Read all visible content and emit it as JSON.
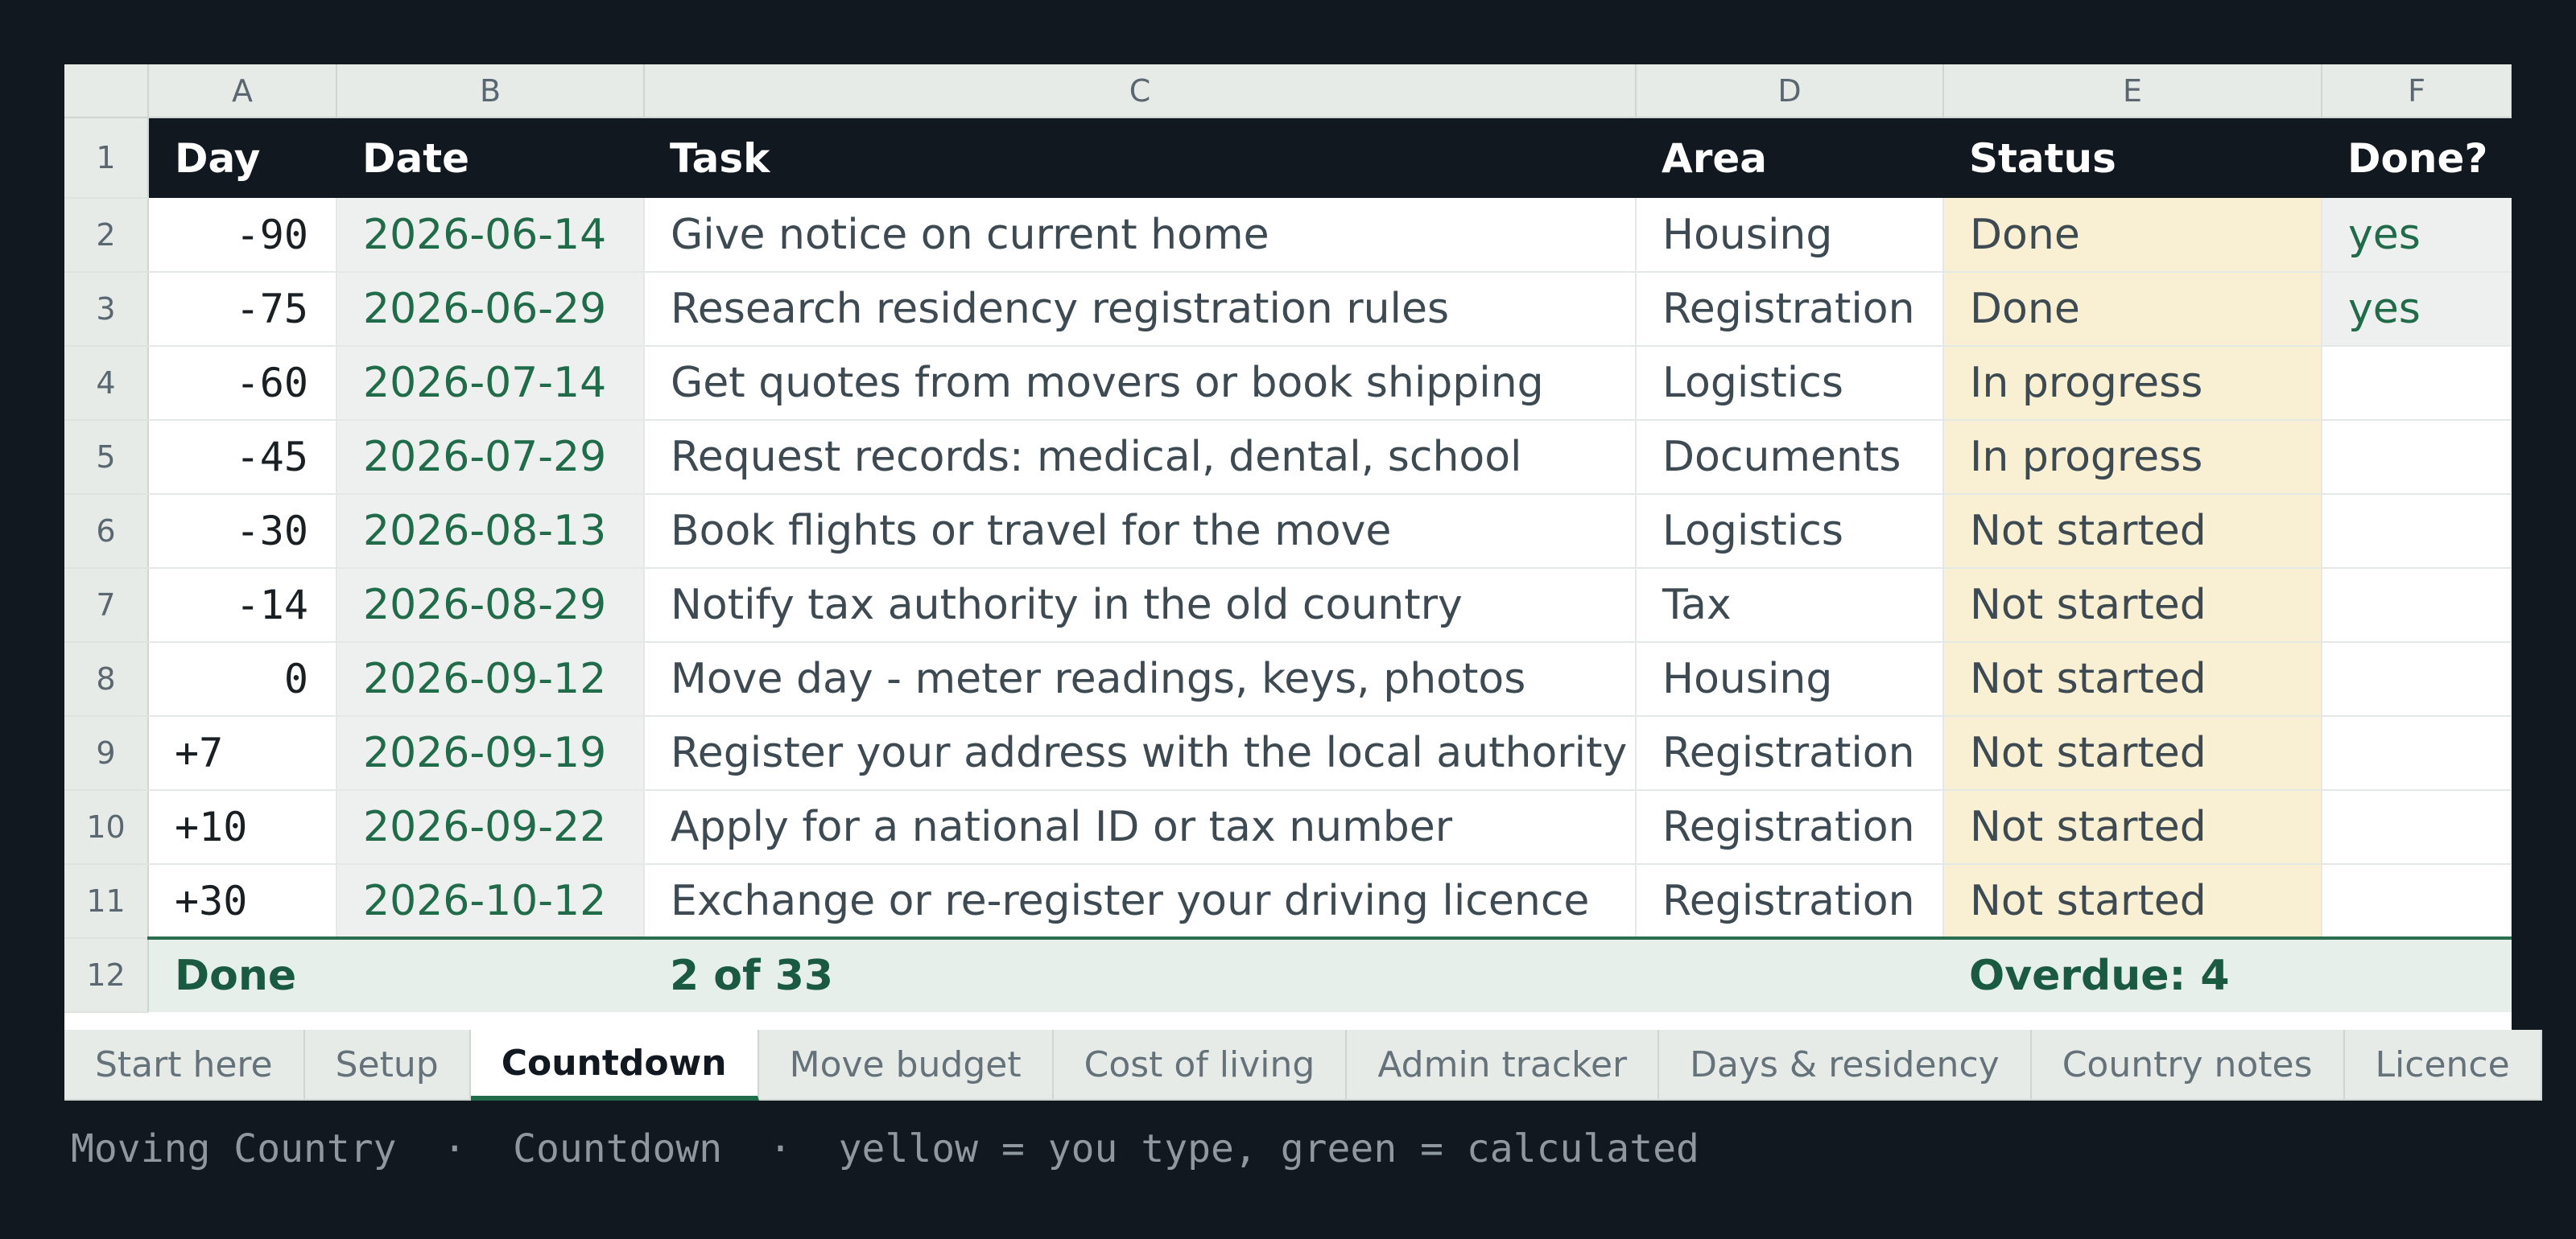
{
  "columns": [
    "A",
    "B",
    "C",
    "D",
    "E",
    "F"
  ],
  "header": {
    "day": "Day",
    "date": "Date",
    "task": "Task",
    "area": "Area",
    "status": "Status",
    "done": "Done?"
  },
  "rows": [
    {
      "num": "2",
      "day": "-90",
      "date": "2026-06-14",
      "task": "Give notice on current home",
      "area": "Housing",
      "status": "Done",
      "done": "yes"
    },
    {
      "num": "3",
      "day": "-75",
      "date": "2026-06-29",
      "task": "Research residency registration rules",
      "area": "Registration",
      "status": "Done",
      "done": "yes"
    },
    {
      "num": "4",
      "day": "-60",
      "date": "2026-07-14",
      "task": "Get quotes from movers or book shipping",
      "area": "Logistics",
      "status": "In progress",
      "done": ""
    },
    {
      "num": "5",
      "day": "-45",
      "date": "2026-07-29",
      "task": "Request records: medical, dental, school",
      "area": "Documents",
      "status": "In progress",
      "done": ""
    },
    {
      "num": "6",
      "day": "-30",
      "date": "2026-08-13",
      "task": "Book flights or travel for the move",
      "area": "Logistics",
      "status": "Not started",
      "done": ""
    },
    {
      "num": "7",
      "day": "-14",
      "date": "2026-08-29",
      "task": "Notify tax authority in the old country",
      "area": "Tax",
      "status": "Not started",
      "done": ""
    },
    {
      "num": "8",
      "day": "0",
      "date": "2026-09-12",
      "task": "Move day - meter readings, keys, photos",
      "area": "Housing",
      "status": "Not started",
      "done": ""
    },
    {
      "num": "9",
      "day": "+7",
      "date": "2026-09-19",
      "task": "Register your address with the local authority",
      "area": "Registration",
      "status": "Not started",
      "done": ""
    },
    {
      "num": "10",
      "day": "+10",
      "date": "2026-09-22",
      "task": "Apply for a national ID or tax number",
      "area": "Registration",
      "status": "Not started",
      "done": ""
    },
    {
      "num": "11",
      "day": "+30",
      "date": "2026-10-12",
      "task": "Exchange or re-register your driving licence",
      "area": "Registration",
      "status": "Not started",
      "done": ""
    }
  ],
  "header_row_num": "1",
  "total": {
    "num": "12",
    "label": "Done",
    "count": "2 of 33",
    "overdue": "Overdue: 4"
  },
  "tabs": [
    "Start here",
    "Setup",
    "Countdown",
    "Move budget",
    "Cost of living",
    "Admin tracker",
    "Days & residency",
    "Country notes",
    "Licence"
  ],
  "active_tab": "Countdown",
  "caption": "Moving Country  ·  Countdown  ·  yellow = you type, green = calculated",
  "colors": {
    "background": "#111820",
    "header_fill": "#111820",
    "input_fill": "#f9f0d3",
    "calc_fill": "#edf0ee",
    "accent_green": "#1f6b4a"
  }
}
